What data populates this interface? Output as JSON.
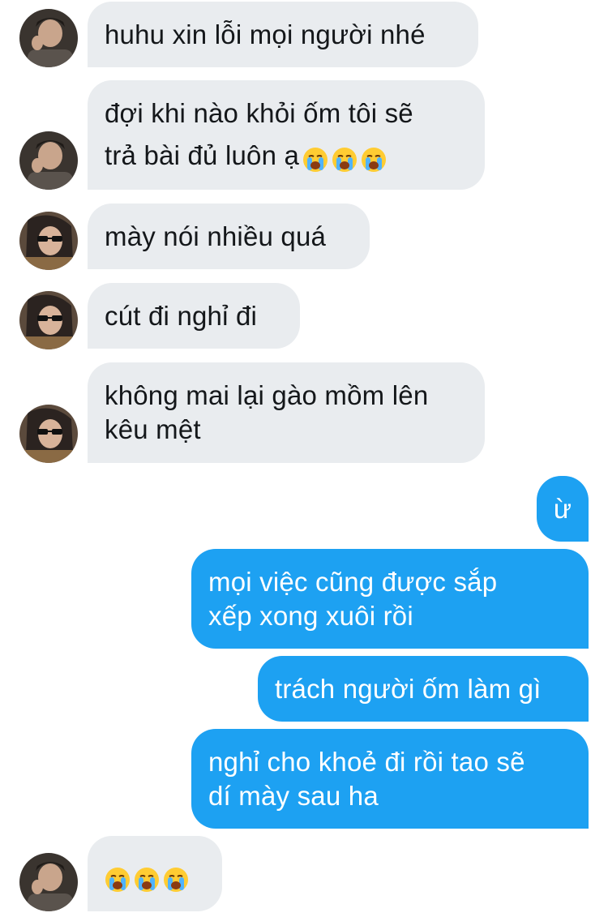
{
  "conversation": {
    "messages": [
      {
        "id": "m1",
        "direction": "incoming",
        "sender": "friend-a",
        "lines": [
          "huhu xin lỗi mọi người nhé"
        ],
        "emoji": []
      },
      {
        "id": "m2",
        "direction": "incoming",
        "sender": "friend-a",
        "lines": [
          "đợi khi nào khỏi ốm tôi sẽ",
          "trả bài đủ luôn ạ"
        ],
        "emoji": [
          "loudly-crying-face",
          "loudly-crying-face",
          "loudly-crying-face"
        ]
      },
      {
        "id": "m3",
        "direction": "incoming",
        "sender": "friend-b",
        "lines": [
          "mày nói nhiều quá"
        ],
        "emoji": []
      },
      {
        "id": "m4",
        "direction": "incoming",
        "sender": "friend-b",
        "lines": [
          "cút đi nghỉ đi"
        ],
        "emoji": []
      },
      {
        "id": "m5",
        "direction": "incoming",
        "sender": "friend-b",
        "lines": [
          "không mai lại gào mồm lên",
          "kêu mệt"
        ],
        "emoji": []
      },
      {
        "id": "m6",
        "direction": "outgoing",
        "sender": "me",
        "lines": [
          "ừ"
        ],
        "emoji": []
      },
      {
        "id": "m7",
        "direction": "outgoing",
        "sender": "me",
        "lines": [
          "mọi việc cũng được sắp",
          "xếp xong xuôi rồi"
        ],
        "emoji": []
      },
      {
        "id": "m8",
        "direction": "outgoing",
        "sender": "me",
        "lines": [
          "trách người ốm làm gì"
        ],
        "emoji": []
      },
      {
        "id": "m9",
        "direction": "outgoing",
        "sender": "me",
        "lines": [
          "nghỉ cho khoẻ đi rồi tao sẽ",
          "dí mày sau ha"
        ],
        "emoji": []
      },
      {
        "id": "m10",
        "direction": "incoming",
        "sender": "friend-a",
        "lines": [],
        "emoji": [
          "loudly-crying-face",
          "loudly-crying-face",
          "loudly-crying-face"
        ]
      }
    ]
  },
  "colors": {
    "incoming_bubble": "#e9ecef",
    "incoming_text": "#14171a",
    "outgoing_bubble": "#1da1f2",
    "outgoing_text": "#ffffff",
    "background": "#ffffff"
  }
}
